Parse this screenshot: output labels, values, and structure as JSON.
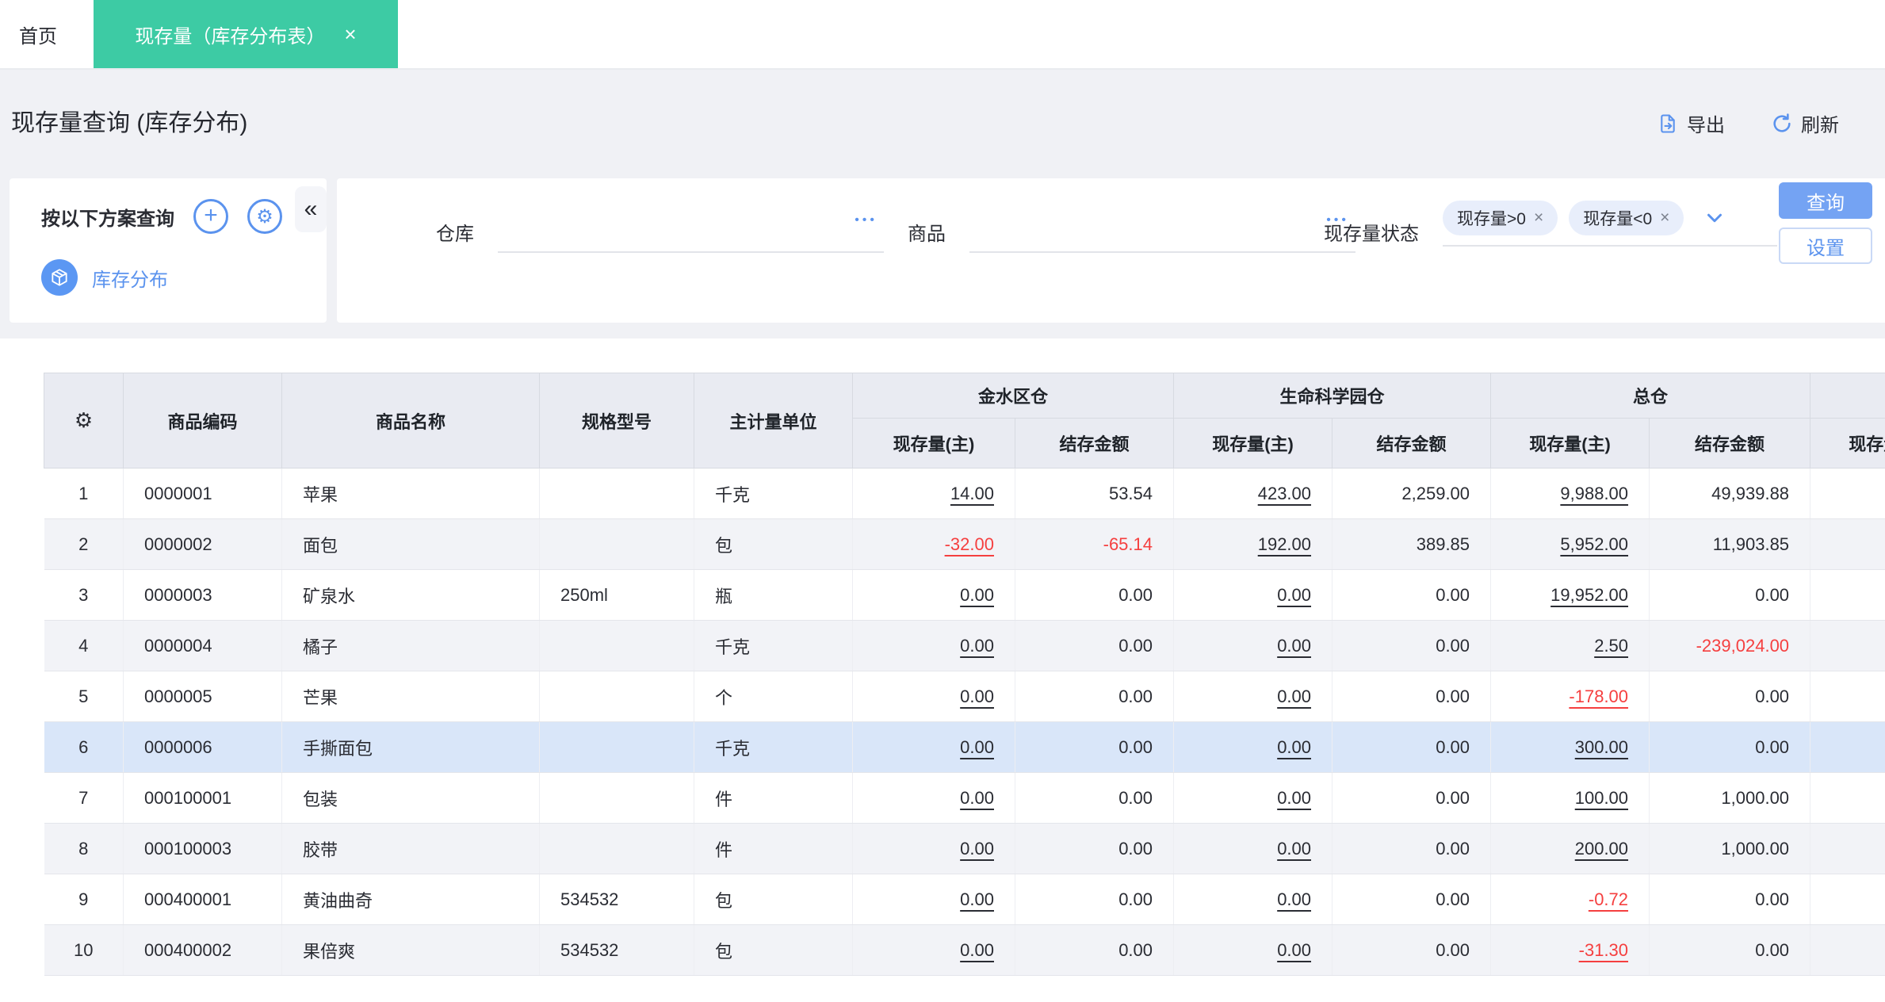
{
  "tabs": {
    "home": "首页",
    "active": "现存量（库存分布表）",
    "close": "×"
  },
  "page": {
    "title": "现存量查询 (库存分布)",
    "export_label": "导出",
    "refresh_label": "刷新"
  },
  "scheme_panel": {
    "title": "按以下方案查询",
    "scheme_label": "库存分布",
    "collapse": "«",
    "plus": "+",
    "gear": "⚙"
  },
  "filters": {
    "warehouse_label": "仓库",
    "product_label": "商品",
    "status_label": "现存量状态",
    "status_tags": [
      "现存量>0",
      "现存量<0"
    ],
    "tag_close": "×",
    "ellipsis": "•••",
    "query_button": "查询",
    "settings_button": "设置"
  },
  "table": {
    "settings_icon": "⚙",
    "fixed_headers": [
      "商品编码",
      "商品名称",
      "规格型号",
      "主计量单位"
    ],
    "warehouse_groups": [
      "金水区仓",
      "生命科学园仓",
      "总仓",
      ""
    ],
    "sub_headers": [
      "现存量(主)",
      "结存金额"
    ],
    "rows": [
      {
        "no": "1",
        "code": "0000001",
        "name": "苹果",
        "spec": "",
        "unit": "千克",
        "selected": false,
        "values": [
          "14.00",
          "53.54",
          "423.00",
          "2,259.00",
          "9,988.00",
          "49,939.88",
          "",
          ""
        ]
      },
      {
        "no": "2",
        "code": "0000002",
        "name": "面包",
        "spec": "",
        "unit": "包",
        "selected": false,
        "values": [
          "-32.00",
          "-65.14",
          "192.00",
          "389.85",
          "5,952.00",
          "11,903.85",
          "",
          ""
        ]
      },
      {
        "no": "3",
        "code": "0000003",
        "name": "矿泉水",
        "spec": "250ml",
        "unit": "瓶",
        "selected": false,
        "values": [
          "0.00",
          "0.00",
          "0.00",
          "0.00",
          "19,952.00",
          "0.00",
          "",
          ""
        ]
      },
      {
        "no": "4",
        "code": "0000004",
        "name": "橘子",
        "spec": "",
        "unit": "千克",
        "selected": false,
        "values": [
          "0.00",
          "0.00",
          "0.00",
          "0.00",
          "2.50",
          "-239,024.00",
          "",
          ""
        ]
      },
      {
        "no": "5",
        "code": "0000005",
        "name": "芒果",
        "spec": "",
        "unit": "个",
        "selected": false,
        "values": [
          "0.00",
          "0.00",
          "0.00",
          "0.00",
          "-178.00",
          "0.00",
          "",
          ""
        ]
      },
      {
        "no": "6",
        "code": "0000006",
        "name": "手撕面包",
        "spec": "",
        "unit": "千克",
        "selected": true,
        "values": [
          "0.00",
          "0.00",
          "0.00",
          "0.00",
          "300.00",
          "0.00",
          "",
          ""
        ]
      },
      {
        "no": "7",
        "code": "000100001",
        "name": "包装",
        "spec": "",
        "unit": "件",
        "selected": false,
        "values": [
          "0.00",
          "0.00",
          "0.00",
          "0.00",
          "100.00",
          "1,000.00",
          "",
          ""
        ]
      },
      {
        "no": "8",
        "code": "000100003",
        "name": "胶带",
        "spec": "",
        "unit": "件",
        "selected": false,
        "values": [
          "0.00",
          "0.00",
          "0.00",
          "0.00",
          "200.00",
          "1,000.00",
          "",
          ""
        ]
      },
      {
        "no": "9",
        "code": "000400001",
        "name": "黄油曲奇",
        "spec": "534532",
        "unit": "包",
        "selected": false,
        "values": [
          "0.00",
          "0.00",
          "0.00",
          "0.00",
          "-0.72",
          "0.00",
          "",
          ""
        ]
      },
      {
        "no": "10",
        "code": "000400002",
        "name": "果倍爽",
        "spec": "534532",
        "unit": "包",
        "selected": false,
        "values": [
          "0.00",
          "0.00",
          "0.00",
          "0.00",
          "-31.30",
          "0.00",
          "",
          ""
        ]
      }
    ]
  },
  "colors": {
    "active_tab_green": "#3DCBA4",
    "accent_blue": "#5B93EE",
    "primary_button_blue": "#74A3F3",
    "negative_red": "#F53F3F",
    "selected_row_blue": "#D9E6F9",
    "header_gray": "#E9EBF2"
  }
}
